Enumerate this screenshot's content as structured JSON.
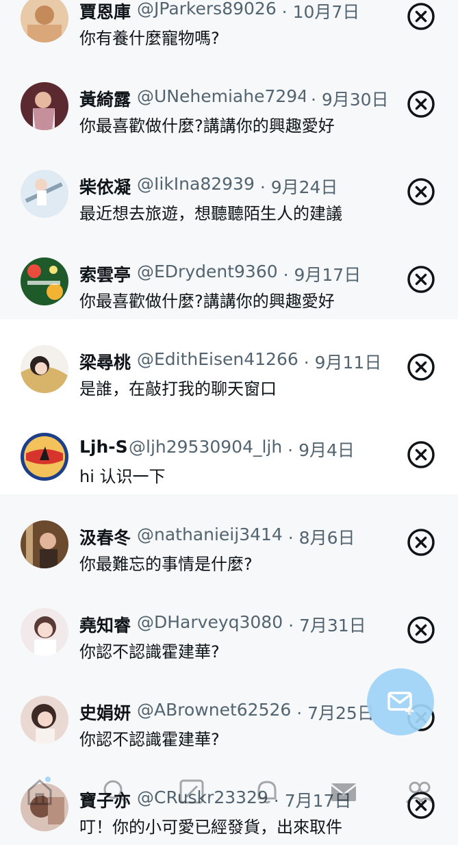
{
  "conversations": [
    {
      "name": "賈恩庫",
      "handle": "@JParkers89026",
      "date": "10月7日",
      "message": "你有養什麼寵物嗎?",
      "state": "unread"
    },
    {
      "name": "黃綺露",
      "handle": "@UNehemiahe72945",
      "date": "9月30日",
      "message": "你最喜歡做什麼?講講你的興趣愛好",
      "state": "unread"
    },
    {
      "name": "柴依凝",
      "handle": "@IikIna82939",
      "date": "9月24日",
      "message": "最近想去旅遊，想聽聽陌生人的建議",
      "state": "unread"
    },
    {
      "name": "索雲亭",
      "handle": "@EDrydent9360",
      "date": "9月17日",
      "message": "你最喜歡做什麼?講講你的興趣愛好",
      "state": "unread"
    },
    {
      "name": "梁尋桃",
      "handle": "@EdithEisen41266",
      "date": "9月11日",
      "message": "是誰，在敲打我的聊天窗口",
      "state": "read"
    },
    {
      "name": "Ljh-S",
      "handle": "@ljh29530904_ljh",
      "date": "9月4日",
      "message": "hi 认识一下",
      "state": "read"
    },
    {
      "name": "汲春冬",
      "handle": "@nathanieij3414",
      "date": "8月6日",
      "message": "你最難忘的事情是什麼?",
      "state": "unread"
    },
    {
      "name": "堯知睿",
      "handle": "@DHarveyq3080",
      "date": "7月31日",
      "message": "你認不認識霍建華?",
      "state": "unread"
    },
    {
      "name": "史娟妍",
      "handle": "@ABrownet62526",
      "date": "7月25日",
      "message": "你認不認識霍建華?",
      "state": "unread"
    },
    {
      "name": "寶子亦",
      "handle": "@CRuskr23329",
      "date": "7月17日",
      "message": "叮！你的小可愛已經發貨，出來取件",
      "state": "unread"
    }
  ],
  "separator": " · ",
  "icons": {
    "dismiss": "close-circle-icon",
    "fab": "new-message-icon",
    "nav": [
      "home-icon",
      "search-icon",
      "communities-icon",
      "notifications-icon",
      "messages-icon",
      "people-icon"
    ]
  },
  "colors": {
    "accent": "#1d9bf0",
    "unread_bg": "#f6f8f9",
    "text": "#0f1419",
    "muted": "#536471"
  }
}
